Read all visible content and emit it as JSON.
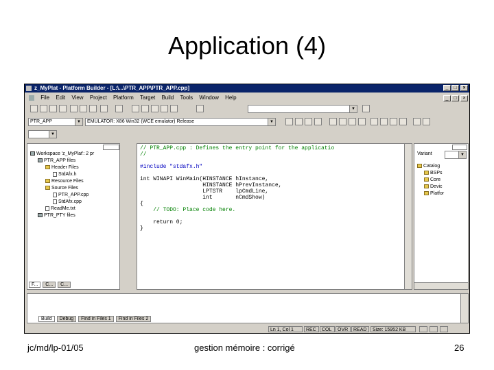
{
  "slide": {
    "title": "Application (4)",
    "footer_left": "jc/md/lp-01/05",
    "footer_center": "gestion mémoire : corrigé",
    "footer_right": "26"
  },
  "window": {
    "title": "z_MyPlat - Platform Builder - [L:\\...\\PTR_APP\\PTR_APP.cpp]",
    "controls": [
      "_",
      "□",
      "×"
    ],
    "doc_controls": [
      "_",
      "□",
      "×"
    ]
  },
  "menu": {
    "items": [
      "File",
      "Edit",
      "View",
      "Project",
      "Platform",
      "Target",
      "Build",
      "Tools",
      "Window",
      "Help"
    ]
  },
  "toolbar": {
    "project_combo": "PTR_APP",
    "config_combo": "EMULATOR: X86 Win32 (WCE emulator) Release"
  },
  "workspace": {
    "tree": [
      {
        "label": "Workspace 'z_MyPlat': 2 pr",
        "icon": "workspace-icon",
        "depth": 0
      },
      {
        "label": "PTR_APP files",
        "icon": "project-icon",
        "depth": 1
      },
      {
        "label": "Header Files",
        "icon": "folder-icon",
        "depth": 2
      },
      {
        "label": "StdAfx.h",
        "icon": "file-icon",
        "depth": 3
      },
      {
        "label": "Resource Files",
        "icon": "folder-icon",
        "depth": 2
      },
      {
        "label": "Source Files",
        "icon": "folder-icon",
        "depth": 2
      },
      {
        "label": "PTR_APP.cpp",
        "icon": "file-icon",
        "depth": 3
      },
      {
        "label": "StdAfx.cpp",
        "icon": "file-icon",
        "depth": 3
      },
      {
        "label": "ReadMe.txt",
        "icon": "file-icon",
        "depth": 2
      },
      {
        "label": "PTR_PTY files",
        "icon": "project-icon",
        "depth": 1
      }
    ],
    "tabs": [
      "F...",
      "C...",
      "C..."
    ]
  },
  "editor": {
    "lines": [
      {
        "text": "// PTR_APP.cpp : Defines the entry point for the applicatio",
        "kind": "cmt"
      },
      {
        "text": "//",
        "kind": "cmt"
      },
      {
        "text": "",
        "kind": "plain"
      },
      {
        "text": "#include \"stdafx.h\"",
        "kind": "kw"
      },
      {
        "text": "",
        "kind": "plain"
      },
      {
        "text": "int WINAPI WinMain(HINSTANCE hInstance,",
        "kind": "plain"
      },
      {
        "text": "                   HINSTANCE hPrevInstance,",
        "kind": "plain"
      },
      {
        "text": "                   LPTSTR    lpCmdLine,",
        "kind": "plain"
      },
      {
        "text": "                   int       nCmdShow)",
        "kind": "plain"
      },
      {
        "text": "{",
        "kind": "plain"
      },
      {
        "text": "    // TODO: Place code here.",
        "kind": "cmt"
      },
      {
        "text": "",
        "kind": "plain"
      },
      {
        "text": "    return 0;",
        "kind": "plain"
      },
      {
        "text": "}",
        "kind": "plain"
      }
    ]
  },
  "catalog": {
    "variant_label": "Variant",
    "tree": [
      {
        "label": "Catalog",
        "depth": 0
      },
      {
        "label": "BSPs",
        "depth": 1
      },
      {
        "label": "Core",
        "depth": 1
      },
      {
        "label": "Devic",
        "depth": 1
      },
      {
        "label": "Platfor",
        "depth": 1
      }
    ]
  },
  "output": {
    "tabs": [
      "Build",
      "Debug",
      "Find in Files 1",
      "Find in Files 2"
    ]
  },
  "statusbar": {
    "position": "Ln 1, Col 1",
    "indicators": [
      "REC",
      "COL",
      "OVR",
      "READ"
    ],
    "size": "Size: 15952 KB"
  }
}
